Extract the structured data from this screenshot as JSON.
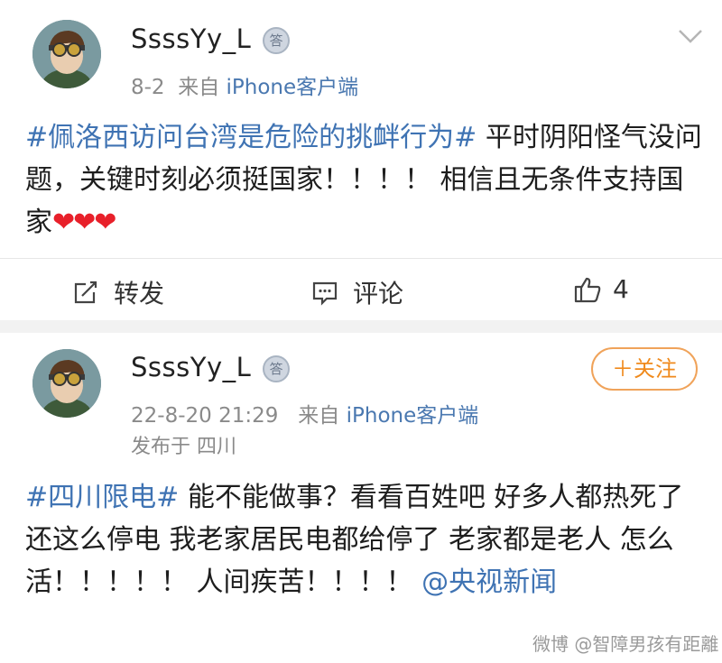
{
  "posts": [
    {
      "username": "SsssYy_L",
      "badge": "答",
      "date": "8-2",
      "from_label": "来自",
      "source": "iPhone客户端",
      "hashtag": "#佩洛西访问台湾是危险的挑衅行为#",
      "text": " 平时阴阳怪气没问题，关键时刻必须挺国家！！！！ 相信且无条件支持国家",
      "hearts": "❤❤❤",
      "actions": {
        "repost": "转发",
        "comment": "评论",
        "like_count": "4"
      }
    },
    {
      "username": "SsssYy_L",
      "badge": "答",
      "date": "22-8-20 21:29",
      "from_label": "来自",
      "source": "iPhone客户端",
      "location": "发布于 四川",
      "follow": "＋关注",
      "hashtag": "#四川限电#",
      "text": " 能不能做事？看看百姓吧 好多人都热死了 还这么停电 我老家居民电都给停了 老家都是老人 怎么活！！！！！ 人间疾苦！！！！ ",
      "mention": "@央视新闻"
    }
  ],
  "watermark": "微博 @智障男孩有距離",
  "icons": [
    "avatar",
    "verified-badge-icon",
    "chevron-down-icon",
    "repost-icon",
    "comment-icon",
    "like-icon"
  ],
  "colors": {
    "link": "#3f73b3",
    "follow": "#f08a1c",
    "heart": "#e8202a",
    "meta": "#8a8a8a"
  }
}
